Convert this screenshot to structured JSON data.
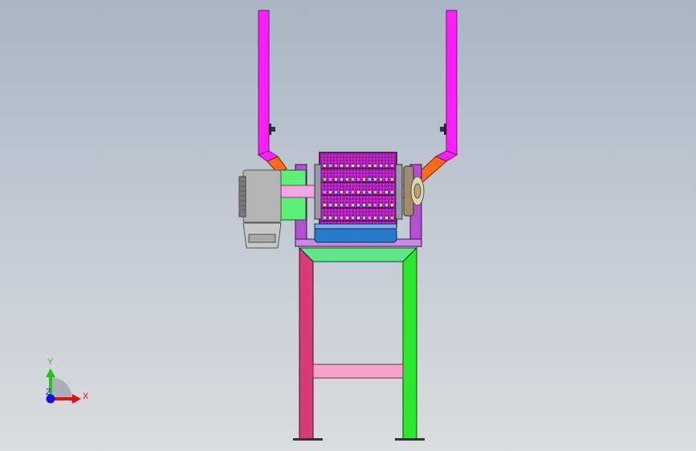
{
  "view": {
    "background_top": "#a9b4c4",
    "background_bottom": "#dadcde"
  },
  "triad": {
    "y_label": "Y",
    "x_label": "X",
    "z_label": "Z",
    "y_color": "#22c222",
    "x_color": "#e01010",
    "z_color": "#1010e0"
  },
  "colors": {
    "chute": "#ff1cff",
    "chute_elbow": "#ff6a1c",
    "motor": "#b4b4b4",
    "motor_mount": "#5ff07a",
    "drum": "#d02ad8",
    "shaft": "#f4a6e6",
    "tray": "#2a7acb",
    "frame_left": "#d63c78",
    "frame_right": "#2ce82c",
    "frame_top": "#5fe58a",
    "cross_brace": "#f7a4cc",
    "housing": "#b34fd0"
  }
}
